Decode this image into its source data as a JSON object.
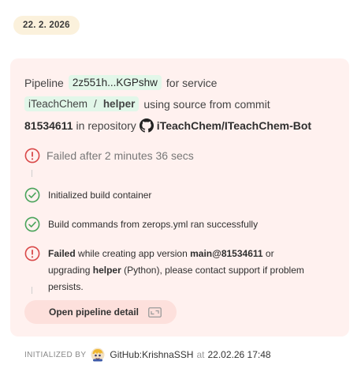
{
  "date_label": "22. 2. 2026",
  "pipeline": {
    "prefix": "Pipeline",
    "id": "2z551h...KGPshw",
    "for_service_text": "for service",
    "project": "iTeachChem",
    "separator": "/",
    "service": "helper",
    "source_text": "using source from commit",
    "commit": "81534611",
    "in_repo_text": "in repository",
    "repository": "iTeachChem/ITeachChem-Bot",
    "repo_icon": "github-icon"
  },
  "status": {
    "title": "Failed after 2 minutes 36 secs",
    "icon": "error-circle-icon"
  },
  "steps": [
    {
      "icon": "check-circle-icon",
      "text": "Initialized build container"
    },
    {
      "icon": "check-circle-icon",
      "text": "Build commands from zerops.yml ran successfully"
    },
    {
      "icon": "error-circle-icon",
      "failed_label": "Failed",
      "part1": "while creating app version",
      "version": "main@81534611",
      "part2": "or upgrading",
      "service": "helper",
      "part3": "(Python), please contact support if problem persists."
    }
  ],
  "open_button_label": "Open pipeline detail",
  "footer": {
    "label": "INITIALIZED BY",
    "user": "GitHub:KrishnaSSH",
    "at": "at",
    "timestamp": "22.02.26 17:48"
  },
  "colors": {
    "success": "#49a35a",
    "error": "#d94848",
    "card_bg": "#fff1ef",
    "chip_bg": "#e2f7e9"
  }
}
